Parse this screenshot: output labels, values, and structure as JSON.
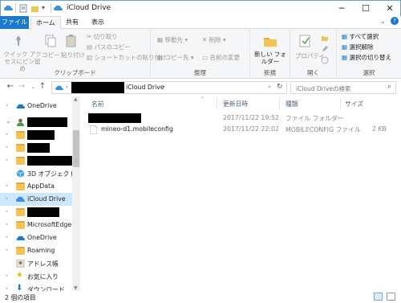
{
  "window": {
    "title": "iCloud Drive"
  },
  "tabs": [
    {
      "label": "ファイル"
    },
    {
      "label": "ホーム"
    },
    {
      "label": "共有"
    },
    {
      "label": "表示"
    }
  ],
  "ribbon": {
    "clipboard": {
      "group_label": "クリップボード",
      "quick_access": "クイック アクセスにピン留め",
      "copy": "コピー",
      "paste": "貼り付け",
      "cut": "切り取り",
      "copy_path": "パスのコピー",
      "paste_shortcut": "ショートカットの貼り付け"
    },
    "organize": {
      "group_label": "整理",
      "move_to": "移動先 ▾",
      "copy_to": "コピー先 ▾",
      "delete": "削除 ▾",
      "rename": "名前の変更"
    },
    "new": {
      "group_label": "新規",
      "new_folder": "新しい フォルダー"
    },
    "open": {
      "group_label": "開く",
      "properties": "プロパティ"
    },
    "select": {
      "group_label": "選択",
      "select_all": "すべて選択",
      "select_none": "選択解除",
      "invert": "選択の切り替え"
    }
  },
  "address": {
    "path_current": "iCloud Drive",
    "search_placeholder": "iCloud Driveの検索"
  },
  "nav_items": [
    {
      "label": "OneDrive",
      "icon": "onedrive-icon"
    },
    {
      "label": "",
      "icon": "user-icon"
    },
    {
      "label": "",
      "icon": "folder-icon"
    },
    {
      "label": "",
      "icon": "folder-icon"
    },
    {
      "label": "",
      "icon": "folder-icon"
    },
    {
      "label": "3D オブジェクト",
      "icon": "3d-objects-icon"
    },
    {
      "label": "AppData",
      "icon": "folder-icon"
    },
    {
      "label": "iCloud Drive",
      "icon": "icloud-icon"
    },
    {
      "label": "",
      "icon": "folder-icon"
    },
    {
      "label": "MicrosoftEdgeBa",
      "icon": "folder-icon"
    },
    {
      "label": "OneDrive",
      "icon": "onedrive-icon"
    },
    {
      "label": "Roaming",
      "icon": "folder-icon"
    },
    {
      "label": "アドレス帳",
      "icon": "contacts-icon"
    },
    {
      "label": "お気に入り",
      "icon": "star-icon"
    },
    {
      "label": "ダウンロード",
      "icon": "download-icon"
    }
  ],
  "columns": {
    "name": "名前",
    "date": "更新日時",
    "type": "種類",
    "size": "サイズ"
  },
  "files": [
    {
      "name": "",
      "date": "2017/11/22 19:52",
      "type": "ファイル フォルダー",
      "size": ""
    },
    {
      "name": "mineo-d1.mobileconfig",
      "date": "2017/11/22 22:02",
      "type": "MOBILECONFIG ファイル",
      "size": "2 KB"
    }
  ],
  "status": {
    "item_count": "2 個の項目"
  },
  "colors": {
    "accent": "#1979ca",
    "selection": "#cce8ff",
    "folder": "#f1c453"
  }
}
